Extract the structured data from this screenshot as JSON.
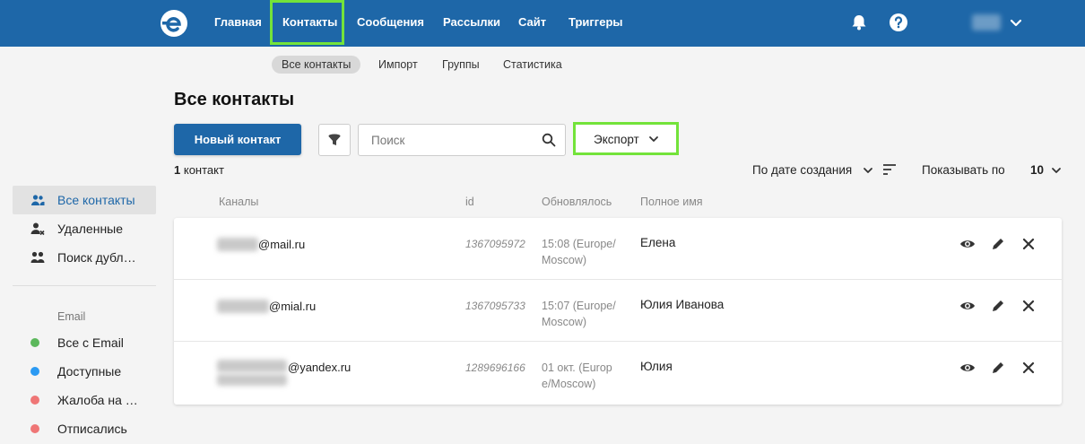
{
  "topnav": {
    "items": [
      "Главная",
      "Контакты",
      "Сообщения",
      "Рассылки",
      "Сайт",
      "Триггеры"
    ],
    "active": "Контакты"
  },
  "subnav": {
    "items": [
      "Все контакты",
      "Импорт",
      "Группы",
      "Статистика"
    ],
    "active": "Все контакты"
  },
  "page": {
    "title": "Все контакты"
  },
  "toolbar": {
    "new_contact": "Новый контакт",
    "search_placeholder": "Поиск",
    "export": "Экспорт"
  },
  "summary": {
    "count": "1",
    "count_label": "контакт"
  },
  "sort": {
    "label": "По дате создания"
  },
  "per_page": {
    "label": "Показывать по",
    "value": "10"
  },
  "sidebar": {
    "items": [
      {
        "label": "Все контакты",
        "icon": "users-icon"
      },
      {
        "label": "Удаленные",
        "icon": "user-remove-icon"
      },
      {
        "label": "Поиск дубл…",
        "icon": "duplicate-users-icon"
      }
    ],
    "section_title": "Email",
    "email_items": [
      {
        "label": "Все с Email",
        "color": "#5cb85c"
      },
      {
        "label": "Доступные",
        "color": "#2b9af3"
      },
      {
        "label": "Жалоба на …",
        "color": "#ef7676"
      },
      {
        "label": "Отписались",
        "color": "#ef7676"
      }
    ]
  },
  "table": {
    "headers": [
      "Каналы",
      "id",
      "Обновлялось",
      "Полное имя"
    ],
    "rows": [
      {
        "email_domain": "@mail.ru",
        "id": "1367095972",
        "updated": "15:08 (Europe/ Moscow)",
        "name": "Елена"
      },
      {
        "email_domain": "@mial.ru",
        "id": "1367095733",
        "updated": "15:07 (Europe/ Moscow)",
        "name": "Юлия Иванова"
      },
      {
        "email_domain": "@yandex.ru",
        "id": "1289696166",
        "updated": "01 окт. (Europ e/Moscow)",
        "name": "Юлия"
      }
    ]
  },
  "colors": {
    "brand": "#1e67a8",
    "highlight": "#73e33a"
  }
}
